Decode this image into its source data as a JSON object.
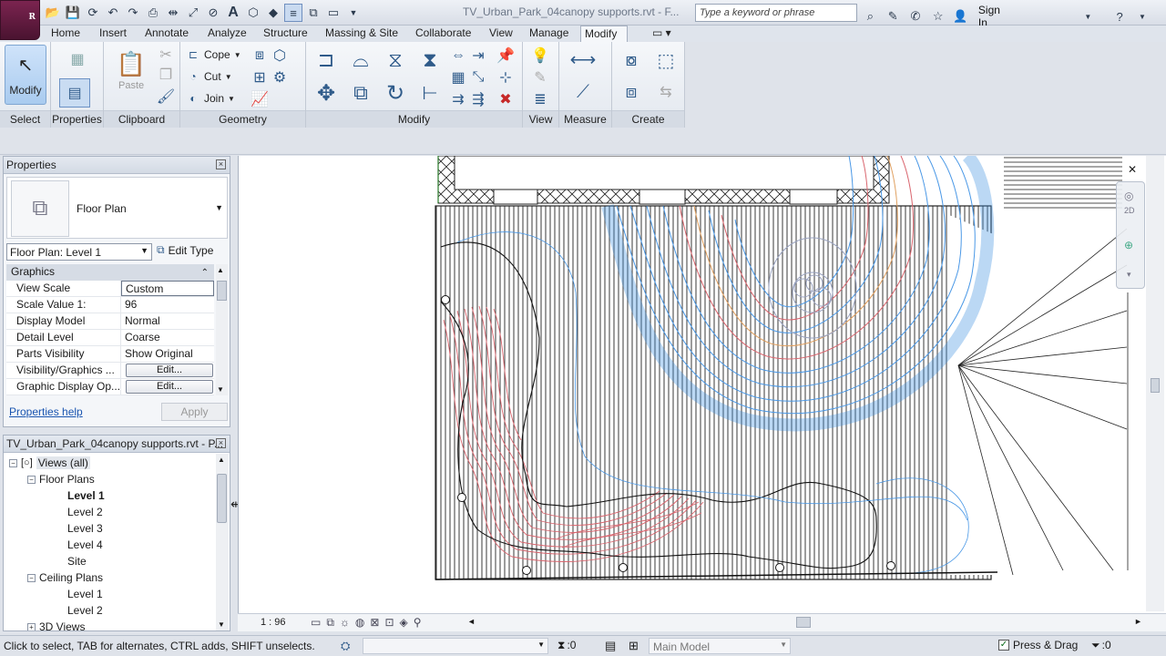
{
  "window": {
    "document_title": "TV_Urban_Park_04canopy supports.rvt - F...",
    "search_placeholder": "Type a keyword or phrase",
    "sign_in": "Sign In",
    "app_logo": "R"
  },
  "tabs": [
    "Home",
    "Insert",
    "Annotate",
    "Analyze",
    "Structure",
    "Massing & Site",
    "Collaborate",
    "View",
    "Manage",
    "Modify"
  ],
  "active_tab": "Modify",
  "ribbon": {
    "select": {
      "modify_label": "Modify",
      "panel": "Select"
    },
    "properties": {
      "panel": "Properties"
    },
    "clipboard": {
      "paste_label": "Paste",
      "panel": "Clipboard"
    },
    "geometry": {
      "cope": "Cope",
      "cut": "Cut",
      "join": "Join",
      "panel": "Geometry"
    },
    "modify": {
      "panel": "Modify"
    },
    "view": {
      "panel": "View"
    },
    "measure": {
      "panel": "Measure"
    },
    "create": {
      "panel": "Create"
    }
  },
  "properties": {
    "title": "Properties",
    "type_name": "Floor Plan",
    "instance_filter": "Floor Plan: Level 1",
    "edit_type": "Edit Type",
    "group": "Graphics",
    "rows": [
      {
        "name": "View Scale",
        "value": "Custom"
      },
      {
        "name": "Scale Value    1:",
        "value": "96"
      },
      {
        "name": "Display Model",
        "value": "Normal"
      },
      {
        "name": "Detail Level",
        "value": "Coarse"
      },
      {
        "name": "Parts Visibility",
        "value": "Show Original"
      },
      {
        "name": "Visibility/Graphics ...",
        "value": "Edit..."
      },
      {
        "name": "Graphic Display Op...",
        "value": "Edit..."
      }
    ],
    "help": "Properties help",
    "apply": "Apply"
  },
  "browser": {
    "title": "TV_Urban_Park_04canopy supports.rvt - P...",
    "nodes": [
      {
        "label": "Views (all)",
        "level": 0,
        "toggle": "−"
      },
      {
        "label": "Floor Plans",
        "level": 1,
        "toggle": "−"
      },
      {
        "label": "Level 1",
        "level": 2,
        "bold": true
      },
      {
        "label": "Level 2",
        "level": 2
      },
      {
        "label": "Level 3",
        "level": 2
      },
      {
        "label": "Level 4",
        "level": 2
      },
      {
        "label": "Site",
        "level": 2
      },
      {
        "label": "Ceiling Plans",
        "level": 1,
        "toggle": "−"
      },
      {
        "label": "Level 1",
        "level": 2
      },
      {
        "label": "Level 2",
        "level": 2
      },
      {
        "label": "3D Views",
        "level": 1,
        "toggle": "+"
      }
    ]
  },
  "view": {
    "scale": "1 : 96"
  },
  "status": {
    "text": "Click to select, TAB for alternates, CTRL adds, SHIFT unselects.",
    "filter_count": ":0",
    "workset": "Main Model",
    "press_drag": "Press & Drag",
    "selection_count": ":0"
  },
  "colors": {
    "contour_blue": "#3d8fe0",
    "contour_red": "#d9656e",
    "contour_orange": "#e0a060",
    "hatch": "#222222",
    "app_brand": "#6b1f44"
  }
}
